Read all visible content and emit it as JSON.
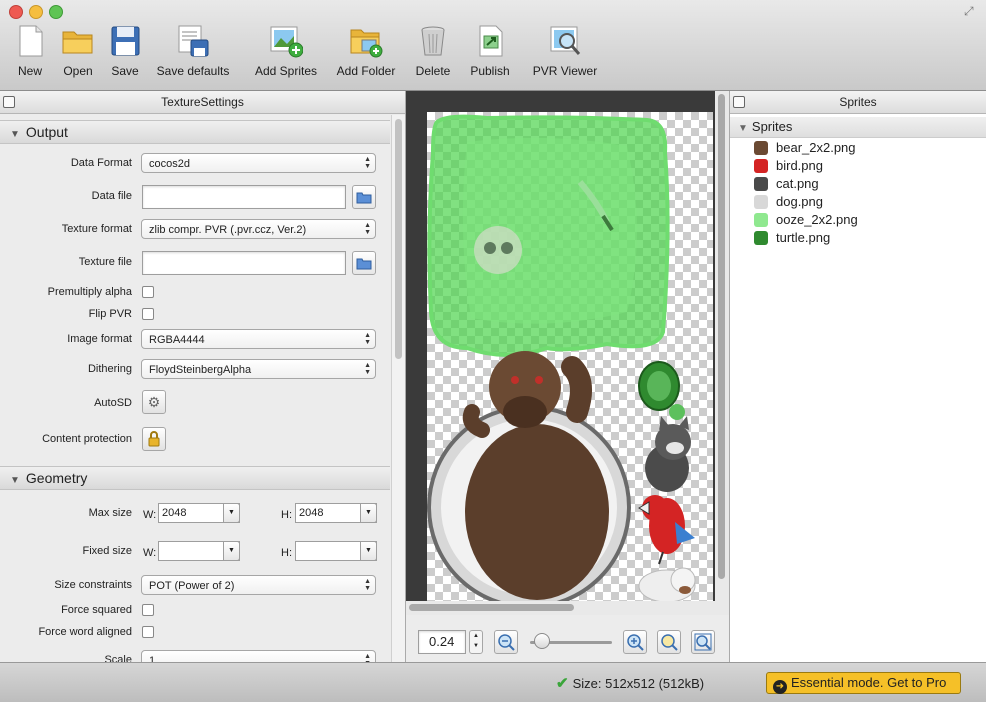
{
  "toolbar": {
    "items": [
      {
        "label": "New",
        "icon": "new-document-icon"
      },
      {
        "label": "Open",
        "icon": "open-folder-icon"
      },
      {
        "label": "Save",
        "icon": "save-floppy-icon"
      },
      {
        "label": "Save defaults",
        "icon": "save-defaults-icon"
      },
      {
        "label": "Add Sprites",
        "icon": "add-sprites-icon"
      },
      {
        "label": "Add Folder",
        "icon": "add-folder-icon"
      },
      {
        "label": "Delete",
        "icon": "trash-can-icon"
      },
      {
        "label": "Publish",
        "icon": "publish-icon"
      },
      {
        "label": "PVR Viewer",
        "icon": "pvr-viewer-icon"
      }
    ]
  },
  "settings": {
    "panel_title": "TextureSettings",
    "output_section": "Output",
    "data_format_label": "Data Format",
    "data_format_value": "cocos2d",
    "data_file_label": "Data file",
    "data_file_value": "",
    "texture_format_label": "Texture format",
    "texture_format_value": "zlib compr. PVR (.pvr.ccz, Ver.2)",
    "texture_file_label": "Texture file",
    "texture_file_value": "",
    "premultiply_label": "Premultiply alpha",
    "flip_pvr_label": "Flip PVR",
    "image_format_label": "Image format",
    "image_format_value": "RGBA4444",
    "dithering_label": "Dithering",
    "dithering_value": "FloydSteinbergAlpha",
    "autosd_label": "AutoSD",
    "content_protection_label": "Content protection",
    "geometry_section": "Geometry",
    "max_size_label": "Max size",
    "w_label": "W:",
    "h_label": "H:",
    "max_w": "2048",
    "max_h": "2048",
    "fixed_size_label": "Fixed size",
    "fixed_w": "",
    "fixed_h": "",
    "size_constraints_label": "Size constraints",
    "size_constraints_value": "POT (Power of 2)",
    "force_squared_label": "Force squared",
    "force_word_aligned_label": "Force word aligned",
    "scale_label": "Scale",
    "scale_value": "1"
  },
  "preview": {
    "zoom_value": "0.24",
    "zoom_slider_fraction": 0.05
  },
  "sprites": {
    "panel_title": "Sprites",
    "root": "Sprites",
    "items": [
      {
        "name": "bear_2x2.png",
        "color": "#6b4a33"
      },
      {
        "name": "bird.png",
        "color": "#d42424"
      },
      {
        "name": "cat.png",
        "color": "#4a4a4a"
      },
      {
        "name": "dog.png",
        "color": "#d8d8d8"
      },
      {
        "name": "ooze_2x2.png",
        "color": "#8fe88f"
      },
      {
        "name": "turtle.png",
        "color": "#2f8a2f"
      }
    ]
  },
  "status": {
    "size_text": "Size: 512x512 (512kB)",
    "pro_text": "Essential mode. Get to Pro"
  }
}
